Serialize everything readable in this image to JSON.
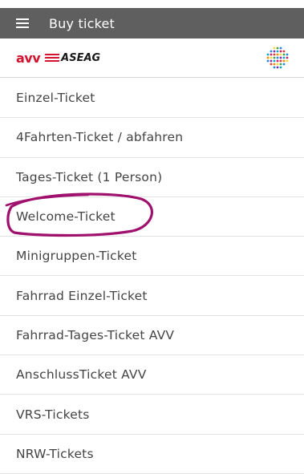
{
  "app": {
    "title": "Buy ticket"
  },
  "logos": {
    "avv": "AVV",
    "aseag": "ASEAG"
  },
  "tickets": [
    {
      "label": "Einzel-Ticket"
    },
    {
      "label": "4Fahrten-Ticket / abfahren"
    },
    {
      "label": "Tages-Ticket (1 Person)"
    },
    {
      "label": "Welcome-Ticket"
    },
    {
      "label": "Minigruppen-Ticket"
    },
    {
      "label": "Fahrrad Einzel-Ticket"
    },
    {
      "label": "Fahrrad-Tages-Ticket AVV"
    },
    {
      "label": "AnschlussTicket AVV"
    },
    {
      "label": "VRS-Tickets"
    },
    {
      "label": "NRW-Tickets"
    }
  ],
  "colors": {
    "appbar": "#5f5f5f",
    "brand_red": "#d2122e",
    "annotation": "#a0116e"
  },
  "icons": {
    "menu": "hamburger-menu-icon",
    "app_logo": "colored-dots-logo-icon"
  }
}
